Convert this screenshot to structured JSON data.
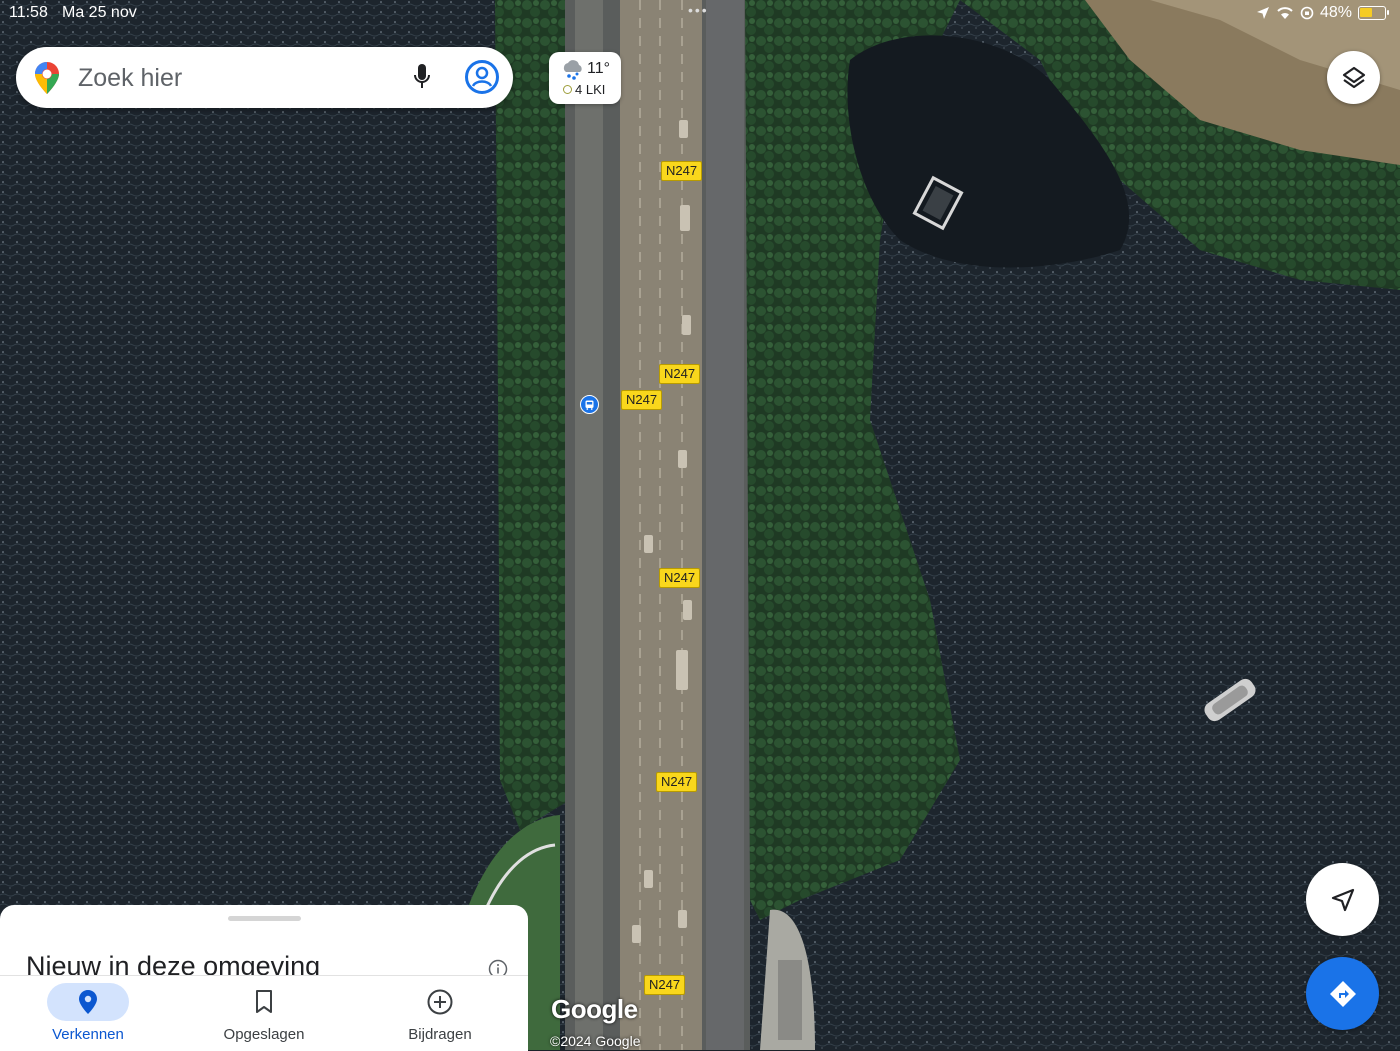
{
  "status_bar": {
    "time": "11:58",
    "date": "Ma 25 nov",
    "battery_percent": "48%",
    "battery_level": 0.48
  },
  "search": {
    "placeholder": "Zoek hier"
  },
  "weather": {
    "temperature": "11°",
    "air_quality": "4 LKI"
  },
  "map": {
    "road_labels": [
      "N247",
      "N247",
      "N247",
      "N247",
      "N247",
      "N247"
    ],
    "branding": "Google",
    "copyright": "©2024 Google"
  },
  "sheet": {
    "title": "Nieuw in deze omgeving"
  },
  "tabs": [
    {
      "label": "Verkennen",
      "icon": "explore-pin-icon",
      "active": true
    },
    {
      "label": "Opgeslagen",
      "icon": "bookmark-icon",
      "active": false
    },
    {
      "label": "Bijdragen",
      "icon": "add-circle-icon",
      "active": false
    }
  ],
  "colors": {
    "accent": "#1a73e8",
    "active_tab_bg": "#d3e3fd",
    "road_shield": "#f9d71c",
    "water": "#1b2229"
  }
}
